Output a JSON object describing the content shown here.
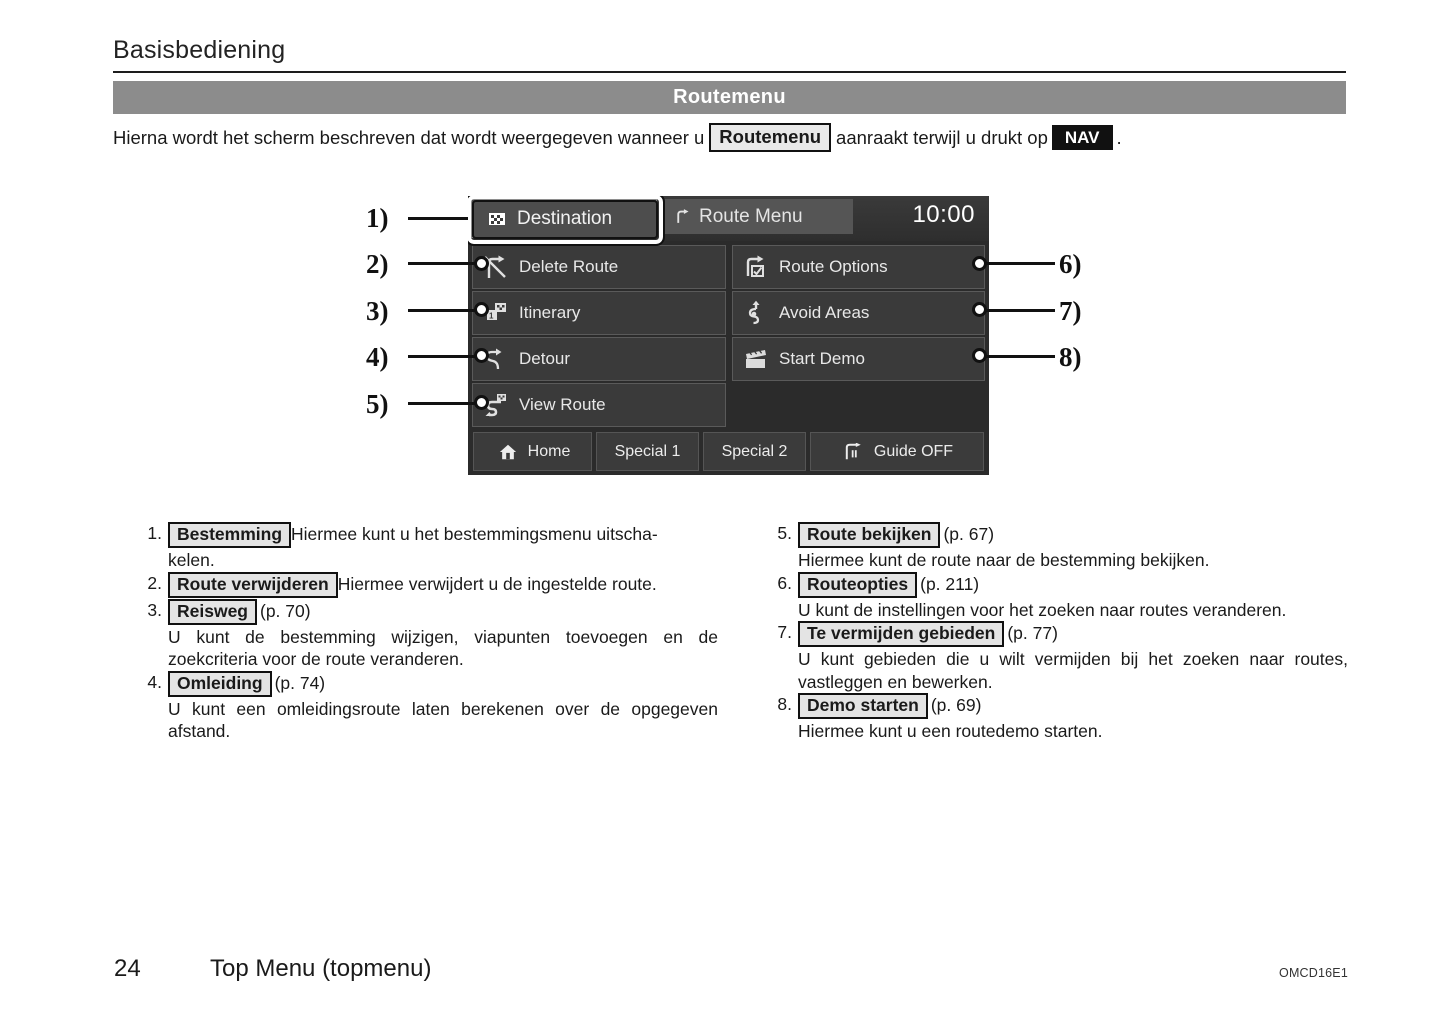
{
  "page": {
    "header_title": "Basisbediening",
    "section_title": "Routemenu",
    "footer_page_number": "24",
    "footer_section": "Top Menu (topmenu)",
    "footer_code": "OMCD16E1"
  },
  "intro": {
    "text_before": "Hierna wordt het scherm beschreven dat wordt weergegeven wanneer u",
    "key_routemenu": "Routemenu",
    "text_middle": "aanraakt terwijl u drukt op",
    "key_nav": "NAV",
    "text_after": "."
  },
  "nav_screen": {
    "destination_tab": "Destination",
    "destination_icon": "checkered-flag-icon",
    "route_menu_tab": "Route Menu",
    "route_menu_icon": "turn-right-arrow-icon",
    "clock": "10:00",
    "tiles": [
      {
        "label": "Delete Route",
        "icon": "delete-route-icon"
      },
      {
        "label": "Route Options",
        "icon": "route-options-icon"
      },
      {
        "label": "Itinerary",
        "icon": "itinerary-icon"
      },
      {
        "label": "Avoid Areas",
        "icon": "avoid-areas-icon"
      },
      {
        "label": "Detour",
        "icon": "detour-icon"
      },
      {
        "label": "Start Demo",
        "icon": "start-demo-icon"
      },
      {
        "label": "View Route",
        "icon": "view-route-icon"
      }
    ],
    "bottom_buttons": [
      {
        "label": "Home",
        "icon": "home-icon"
      },
      {
        "label": "Special 1",
        "icon": ""
      },
      {
        "label": "Special 2",
        "icon": ""
      },
      {
        "label": "Guide OFF",
        "icon": "guide-off-icon"
      }
    ]
  },
  "callouts": {
    "left": [
      "1)",
      "2)",
      "3)",
      "4)",
      "5)"
    ],
    "right": [
      "6)",
      "7)",
      "8)"
    ]
  },
  "descriptions": {
    "left": [
      {
        "num": "1.",
        "button": "Bestemming",
        "page": "",
        "head_tail": "Hiermee kunt u het bestemmingsmenu uitscha-",
        "body": "kelen."
      },
      {
        "num": "2.",
        "button": "Route verwijderen",
        "page": "",
        "head_tail": "Hiermee verwijdert u de ingestelde route.",
        "body": ""
      },
      {
        "num": "3.",
        "button": "Reisweg",
        "page": "(p. 70)",
        "head_tail": "",
        "body": "U kunt de bestemming wijzigen, viapunten toevoegen en de zoekcriteria voor de route veranderen."
      },
      {
        "num": "4.",
        "button": "Omleiding",
        "page": "(p. 74)",
        "head_tail": "",
        "body": "U kunt een omleidingsroute laten berekenen over de opgegeven afstand."
      }
    ],
    "right": [
      {
        "num": "5.",
        "button": "Route bekijken",
        "page": "(p. 67)",
        "head_tail": "",
        "body": "Hiermee kunt de route naar de bestemming bekijken."
      },
      {
        "num": "6.",
        "button": "Routeopties",
        "page": "(p. 211)",
        "head_tail": "",
        "body": "U kunt de instellingen voor het zoeken naar routes veranderen."
      },
      {
        "num": "7.",
        "button": "Te vermijden gebieden",
        "page": "(p. 77)",
        "head_tail": "",
        "body": "U kunt gebieden die u wilt vermijden bij het zoeken naar routes, vastleggen en bewerken."
      },
      {
        "num": "8.",
        "button": "Demo starten",
        "page": "(p. 69)",
        "head_tail": "",
        "body": "Hiermee kunt u een routedemo starten."
      }
    ]
  },
  "colors": {
    "section_bar": "#8c8c8c",
    "nav_background": "#2b2b2b",
    "nav_tile": "#3a3a3a",
    "highlight": "#ffffff"
  }
}
